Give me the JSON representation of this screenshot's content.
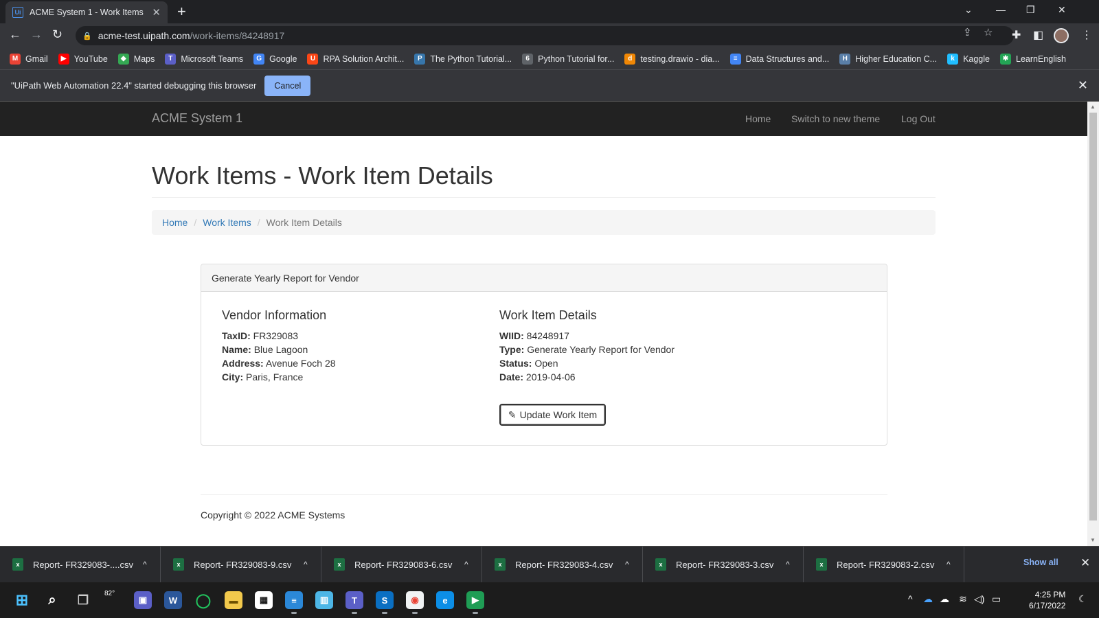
{
  "browser": {
    "tab_title": "ACME System 1 - Work Items",
    "url_host": "acme-test.uipath.com",
    "url_path": "/work-items/84248917",
    "bookmarks": [
      {
        "label": "Gmail",
        "icon": "gmail-icon",
        "color": "#ea4335",
        "glyph": "M"
      },
      {
        "label": "YouTube",
        "icon": "youtube-icon",
        "color": "#ff0000",
        "glyph": "▶"
      },
      {
        "label": "Maps",
        "icon": "maps-icon",
        "color": "#34a853",
        "glyph": "◆"
      },
      {
        "label": "Microsoft Teams",
        "icon": "teams-icon",
        "color": "#5b5fc7",
        "glyph": "T"
      },
      {
        "label": "Google",
        "icon": "google-icon",
        "color": "#4285f4",
        "glyph": "G"
      },
      {
        "label": "RPA Solution Archit...",
        "icon": "uipath-icon",
        "color": "#fa4616",
        "glyph": "U"
      },
      {
        "label": "The Python Tutorial...",
        "icon": "python-icon",
        "color": "#3776ab",
        "glyph": "P"
      },
      {
        "label": "Python Tutorial for...",
        "icon": "tutorial-icon",
        "color": "#5f6368",
        "glyph": "6"
      },
      {
        "label": "testing.drawio - dia...",
        "icon": "drawio-icon",
        "color": "#f08705",
        "glyph": "d"
      },
      {
        "label": "Data Structures and...",
        "icon": "docs-icon",
        "color": "#4285f4",
        "glyph": "≡"
      },
      {
        "label": "Higher Education C...",
        "icon": "education-icon",
        "color": "#5a7fa8",
        "glyph": "H"
      },
      {
        "label": "Kaggle",
        "icon": "kaggle-icon",
        "color": "#20beff",
        "glyph": "k"
      },
      {
        "label": "LearnEnglish",
        "icon": "learnenglish-icon",
        "color": "#23a455",
        "glyph": "✱"
      }
    ],
    "infobar_text": "\"UiPath Web Automation 22.4\" started debugging this browser",
    "infobar_cancel": "Cancel"
  },
  "app": {
    "brand": "ACME System 1",
    "nav": {
      "home": "Home",
      "theme": "Switch to new theme",
      "logout": "Log Out"
    },
    "page_title": "Work Items - Work Item Details",
    "breadcrumb": {
      "home": "Home",
      "work_items": "Work Items",
      "current": "Work Item Details",
      "separator": "/"
    },
    "panel_heading": "Generate Yearly Report for Vendor",
    "vendor": {
      "heading": "Vendor Information",
      "taxid_label": "TaxID:",
      "taxid": "FR329083",
      "name_label": "Name:",
      "name": "Blue Lagoon",
      "address_label": "Address:",
      "address": "Avenue Foch 28",
      "city_label": "City:",
      "city": "Paris, France"
    },
    "work_item": {
      "heading": "Work Item Details",
      "wiid_label": "WIID:",
      "wiid": "84248917",
      "type_label": "Type:",
      "type": "Generate Yearly Report for Vendor",
      "status_label": "Status:",
      "status": "Open",
      "date_label": "Date:",
      "date": "2019-04-06"
    },
    "update_button": "Update Work Item",
    "copyright": "Copyright © 2022 ACME Systems"
  },
  "downloads": {
    "items": [
      "Report- FR329083-....csv",
      "Report- FR329083-9.csv",
      "Report- FR329083-6.csv",
      "Report- FR329083-4.csv",
      "Report- FR329083-3.csv",
      "Report- FR329083-2.csv"
    ],
    "show_all": "Show all"
  },
  "taskbar": {
    "temperature": "82°",
    "time": "4:25 PM",
    "date": "6/17/2022"
  }
}
